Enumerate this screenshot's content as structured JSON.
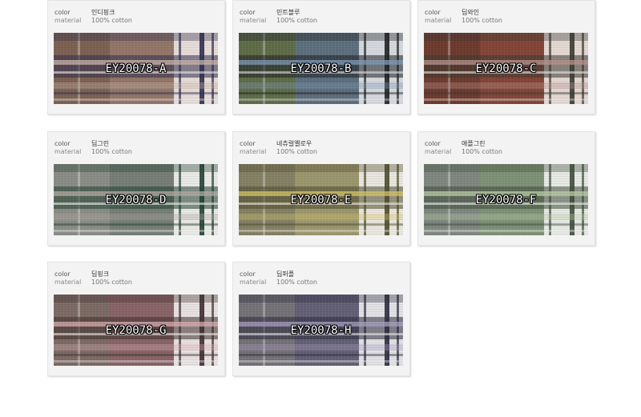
{
  "labels": {
    "color": "color",
    "material": "material"
  },
  "swatches": [
    {
      "color_name": "인디핑크",
      "material": "100% cotton",
      "code": "EY20078-A",
      "palette": [
        "#7c6152",
        "#2f2d4e",
        "#c8b4aa",
        "#9a7e70",
        "#efe7e4"
      ]
    },
    {
      "color_name": "민트블루",
      "material": "100% cotton",
      "code": "EY20078-B",
      "palette": [
        "#5f6c47",
        "#1e2024",
        "#7f9ab8",
        "#5c6f8e",
        "#dfe3ea"
      ]
    },
    {
      "color_name": "딥와인",
      "material": "100% cotton",
      "code": "EY20078-C",
      "palette": [
        "#6d3a2e",
        "#3a3a33",
        "#b8938c",
        "#8b4a3c",
        "#efe6e2"
      ]
    },
    {
      "color_name": "딥그린",
      "material": "100% cotton",
      "code": "EY20078-D",
      "palette": [
        "#8a8c86",
        "#234032",
        "#b3aba1",
        "#6f7a70",
        "#f1f1ef"
      ]
    },
    {
      "color_name": "네츄럴옐로우",
      "material": "100% cotton",
      "code": "EY20078-E",
      "palette": [
        "#838064",
        "#4e4b2c",
        "#d6c56a",
        "#a39d72",
        "#f1efe8"
      ]
    },
    {
      "color_name": "애플그린",
      "material": "100% cotton",
      "code": "EY20078-F",
      "palette": [
        "#7f8680",
        "#3f4d3a",
        "#b9cda7",
        "#7e9473",
        "#f0f2ee"
      ]
    },
    {
      "color_name": "딥핑크",
      "material": "100% cotton",
      "code": "EY20078-G",
      "palette": [
        "#7c6a64",
        "#3e2f2d",
        "#d9aeb3",
        "#8c6268",
        "#f1ecec"
      ]
    },
    {
      "color_name": "딥퍼플",
      "material": "100% cotton",
      "code": "EY20078-H",
      "palette": [
        "#747177",
        "#2b2a3d",
        "#a89fc0",
        "#5d5a74",
        "#ecebef"
      ]
    }
  ]
}
